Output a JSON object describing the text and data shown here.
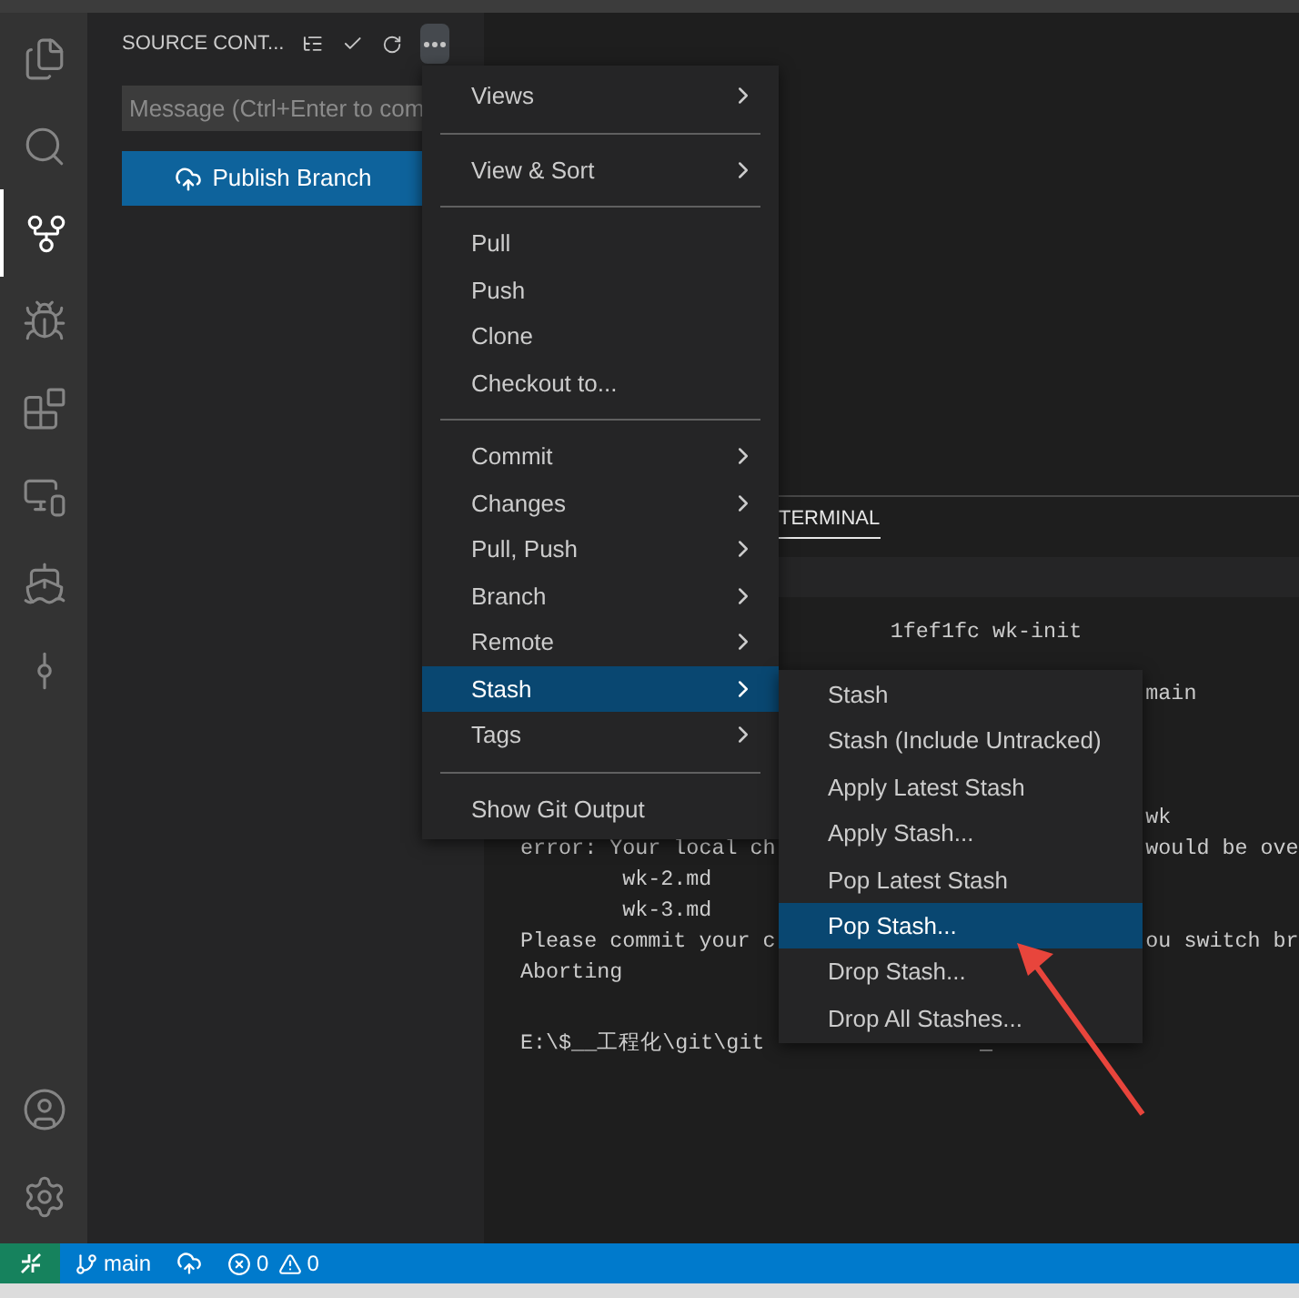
{
  "activity_bar": {
    "items": [
      {
        "kind": "files",
        "selected": false
      },
      {
        "kind": "search",
        "selected": false
      },
      {
        "kind": "source-control",
        "selected": true
      },
      {
        "kind": "run",
        "selected": false
      },
      {
        "kind": "extensions",
        "selected": false
      },
      {
        "kind": "remote",
        "selected": false
      },
      {
        "kind": "docker",
        "selected": false
      },
      {
        "kind": "timeline",
        "selected": false
      }
    ],
    "bottom_items": [
      {
        "kind": "account"
      },
      {
        "kind": "settings"
      }
    ]
  },
  "sidebar": {
    "title": "SOURCE CONT...",
    "message": {
      "placeholder": "Message (Ctrl+Enter to com"
    },
    "publish_button": "Publish Branch"
  },
  "panel": {
    "tab": "TERMINAL",
    "lines": [
      {
        "segments": [
          "1fef1fc wk-init"
        ]
      },
      {
        "segments": [
          "main"
        ]
      },
      {
        "segments": [
          "wk"
        ]
      },
      {
        "segments": [
          "error: Your local ch",
          "would be ove"
        ]
      },
      {
        "segments": [
          "wk-2.md"
        ]
      },
      {
        "segments": [
          "wk-3.md"
        ]
      },
      {
        "segments": [
          "Please commit your c",
          "ou switch br"
        ]
      },
      {
        "segments": [
          "Aborting"
        ]
      },
      {
        "segments": [
          "E:\\$__工程化\\git\\git",
          "_"
        ]
      }
    ]
  },
  "menu": {
    "items": [
      {
        "kind": "submenu",
        "label": "Views",
        "selected": false
      },
      {
        "kind": "separator"
      },
      {
        "kind": "submenu",
        "label": "View & Sort",
        "selected": false
      },
      {
        "kind": "separator"
      },
      {
        "kind": "item",
        "label": "Pull",
        "selected": false
      },
      {
        "kind": "item",
        "label": "Push",
        "selected": false
      },
      {
        "kind": "item",
        "label": "Clone",
        "selected": false
      },
      {
        "kind": "item",
        "label": "Checkout to...",
        "selected": false
      },
      {
        "kind": "separator"
      },
      {
        "kind": "submenu",
        "label": "Commit",
        "selected": false
      },
      {
        "kind": "submenu",
        "label": "Changes",
        "selected": false
      },
      {
        "kind": "submenu",
        "label": "Pull, Push",
        "selected": false
      },
      {
        "kind": "submenu",
        "label": "Branch",
        "selected": false
      },
      {
        "kind": "submenu",
        "label": "Remote",
        "selected": false
      },
      {
        "kind": "submenu",
        "label": "Stash",
        "selected": true
      },
      {
        "kind": "submenu",
        "label": "Tags",
        "selected": false
      },
      {
        "kind": "separator"
      },
      {
        "kind": "item",
        "label": "Show Git Output",
        "selected": false
      }
    ]
  },
  "submenu": {
    "items": [
      {
        "label": "Stash",
        "selected": false
      },
      {
        "label": "Stash (Include Untracked)",
        "selected": false
      },
      {
        "label": "Apply Latest Stash",
        "selected": false
      },
      {
        "label": "Apply Stash...",
        "selected": false
      },
      {
        "label": "Pop Latest Stash",
        "selected": false
      },
      {
        "label": "Pop Stash...",
        "selected": true
      },
      {
        "label": "Drop Stash...",
        "selected": false
      },
      {
        "label": "Drop All Stashes...",
        "selected": false
      }
    ]
  },
  "status_bar": {
    "branch": "main",
    "errors": "0",
    "warnings": "0"
  }
}
